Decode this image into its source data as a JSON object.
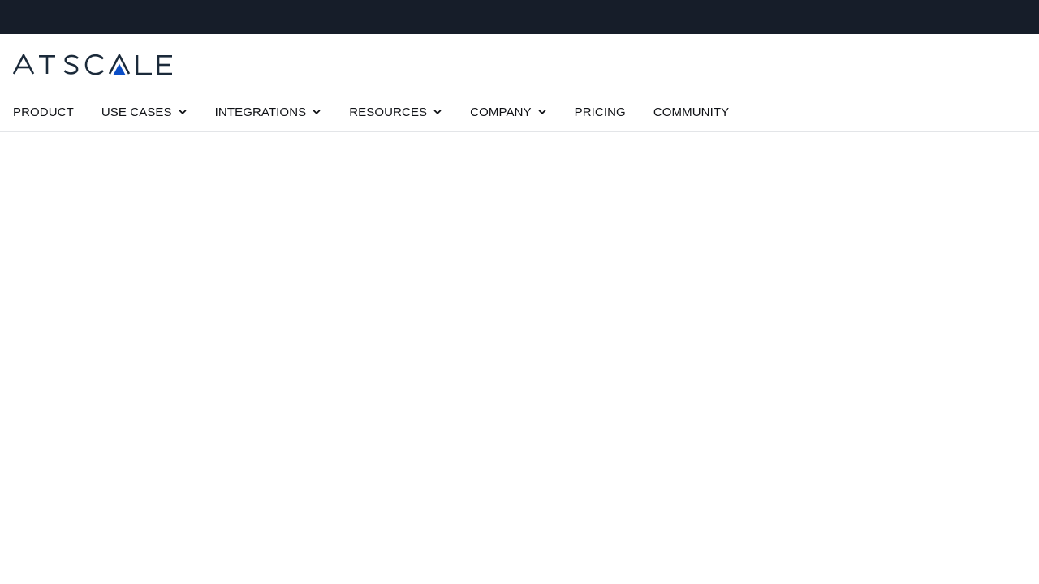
{
  "brand": {
    "logo_text": "ATSCALE",
    "logo_icon": "atscale-logo",
    "colors": {
      "top_bar": "#161d29",
      "logo_text": "#1b2a3a",
      "logo_accent": "#0b4ec7",
      "nav_text": "#0f1115",
      "divider": "#e3e5e8"
    }
  },
  "nav": {
    "items": [
      {
        "label": "PRODUCT",
        "has_dropdown": false
      },
      {
        "label": "USE CASES",
        "has_dropdown": true,
        "icon": "chevron-down-icon"
      },
      {
        "label": "INTEGRATIONS",
        "has_dropdown": true,
        "icon": "chevron-down-icon"
      },
      {
        "label": "RESOURCES",
        "has_dropdown": true,
        "icon": "chevron-down-icon"
      },
      {
        "label": "COMPANY",
        "has_dropdown": true,
        "icon": "chevron-down-icon"
      },
      {
        "label": "PRICING",
        "has_dropdown": false
      },
      {
        "label": "COMMUNITY",
        "has_dropdown": false
      }
    ]
  }
}
